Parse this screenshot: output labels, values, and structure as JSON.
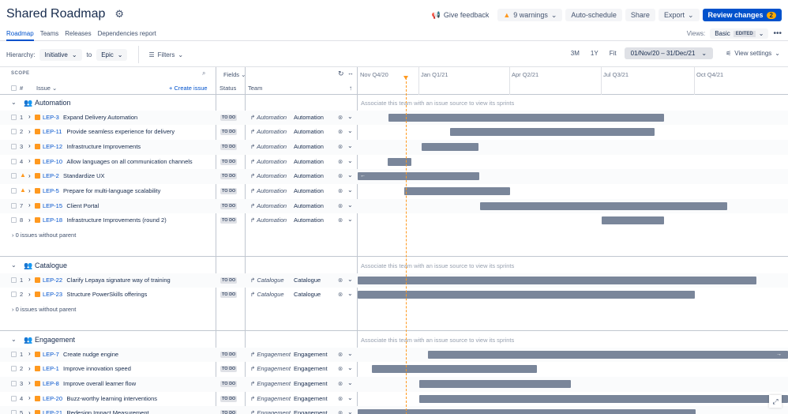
{
  "header": {
    "title": "Shared Roadmap",
    "give_feedback": "Give feedback",
    "warnings": "9 warnings",
    "auto_schedule": "Auto-schedule",
    "share": "Share",
    "export": "Export",
    "review_changes": "Review changes",
    "review_count": "2"
  },
  "tabs": [
    "Roadmap",
    "Teams",
    "Releases",
    "Dependencies report"
  ],
  "views": {
    "label": "Views:",
    "selected": "Basic",
    "edited": "EDITED"
  },
  "toolbar": {
    "hierarchy_label": "Hierarchy:",
    "from": "Initiative",
    "to_label": "to",
    "to": "Epic",
    "filters": "Filters",
    "zoom": [
      "3M",
      "1Y",
      "Fit"
    ],
    "range": "01/Nov/20 – 31/Dec/21",
    "view_settings": "View settings"
  },
  "columns": {
    "scope": "SCOPE",
    "num": "#",
    "issue": "Issue",
    "create": "+ Create issue",
    "fields": "Fields",
    "status": "Status",
    "team": "Team"
  },
  "quarters": [
    "Nov Q4/20",
    "Jan Q1/21",
    "Apr Q2/21",
    "Jul Q3/21",
    "Oct Q4/21"
  ],
  "sprint_note": "Associate this team with an issue source to view its sprints",
  "no_parent": "0 issues without parent",
  "groups": [
    {
      "name": "Automation",
      "rows": [
        {
          "n": "1",
          "key": "LEP-3",
          "summary": "Expand Delivery Automation",
          "status": "TO DO",
          "team_it": "Automation",
          "team": "Automation",
          "bar": [
            492,
            841
          ]
        },
        {
          "n": "2",
          "key": "LEP-11",
          "summary": "Provide seamless experience for delivery",
          "status": "TO DO",
          "team_it": "Automation",
          "team": "Automation",
          "bar": [
            570,
            829
          ]
        },
        {
          "n": "3",
          "key": "LEP-12",
          "summary": "Infrastructure Improvements",
          "status": "TO DO",
          "team_it": "Automation",
          "team": "Automation",
          "bar": [
            534,
            606
          ]
        },
        {
          "n": "4",
          "key": "LEP-10",
          "summary": "Allow languages on all communication channels",
          "status": "TO DO",
          "team_it": "Automation",
          "team": "Automation",
          "bar": [
            491,
            521
          ]
        },
        {
          "n": "",
          "warn": true,
          "key": "LEP-2",
          "summary": "Standardize UX",
          "status": "TO DO",
          "team_it": "Automation",
          "team": "Automation",
          "bar": [
            453,
            607
          ],
          "arrow": "←"
        },
        {
          "n": "",
          "warn": true,
          "key": "LEP-5",
          "summary": "Prepare for multi-language scalability",
          "status": "TO DO",
          "team_it": "Automation",
          "team": "Automation",
          "bar": [
            512,
            646
          ]
        },
        {
          "n": "7",
          "key": "LEP-15",
          "summary": "Client Portal",
          "status": "TO DO",
          "team_it": "Automation",
          "team": "Automation",
          "bar": [
            608,
            921
          ]
        },
        {
          "n": "8",
          "key": "LEP-18",
          "summary": "Infrastructure Improvements (round 2)",
          "status": "TO DO",
          "team_it": "Automation",
          "team": "Automation",
          "bar": [
            762,
            841
          ]
        }
      ]
    },
    {
      "name": "Catalogue",
      "rows": [
        {
          "n": "1",
          "key": "LEP-22",
          "summary": "Clarify Lepaya signature way of training",
          "status": "TO DO",
          "team_it": "Catalogue",
          "team": "Catalogue",
          "bar": [
            453,
            958
          ]
        },
        {
          "n": "2",
          "key": "LEP-23",
          "summary": "Structure PowerSkills offerings",
          "status": "TO DO",
          "team_it": "Catalogue",
          "team": "Catalogue",
          "bar": [
            453,
            880
          ]
        }
      ]
    },
    {
      "name": "Engagement",
      "rows": [
        {
          "n": "1",
          "key": "LEP-7",
          "summary": "Create nudge engine",
          "status": "TO DO",
          "team_it": "Engagement",
          "team": "Engagement",
          "bar": [
            542,
            998
          ],
          "arrow_r": "→"
        },
        {
          "n": "2",
          "key": "LEP-1",
          "summary": "Improve innovation speed",
          "status": "TO DO",
          "team_it": "Engagement",
          "team": "Engagement",
          "bar": [
            471,
            680
          ]
        },
        {
          "n": "3",
          "key": "LEP-8",
          "summary": "Improve overall learner flow",
          "status": "TO DO",
          "team_it": "Engagement",
          "team": "Engagement",
          "bar": [
            531,
            723
          ]
        },
        {
          "n": "4",
          "key": "LEP-20",
          "summary": "Buzz-worthy learning interventions",
          "status": "TO DO",
          "team_it": "Engagement",
          "team": "Engagement",
          "bar": [
            531,
            998
          ]
        },
        {
          "n": "5",
          "key": "LEP-21",
          "summary": "Redesign Impact Measurement",
          "status": "TO DO",
          "team_it": "Engagement",
          "team": "Engagement",
          "bar": [
            453,
            881
          ]
        }
      ]
    }
  ]
}
